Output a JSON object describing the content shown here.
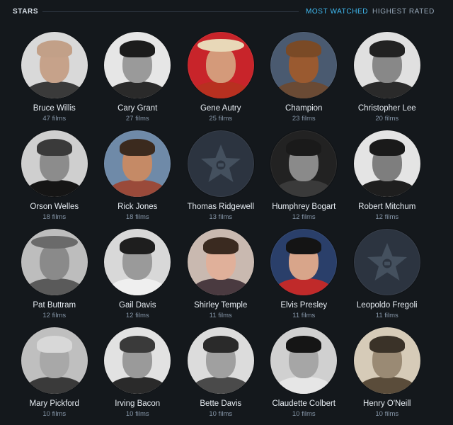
{
  "header": {
    "section_title": "STARS",
    "tab_most_watched": "MOST WATCHED",
    "tab_highest_rated": "HIGHEST RATED"
  },
  "colors": {
    "background": "#14181c",
    "accent": "#40bcf4",
    "muted": "#8696a8",
    "placeholder": "#2c3440"
  },
  "stars": [
    {
      "name": "Bruce Willis",
      "count": "47 films",
      "photo": true,
      "bg": "#d9d9d9",
      "skin": "#c6a28a",
      "hair": "#c2a088",
      "cloth": "#3a3a3a"
    },
    {
      "name": "Cary Grant",
      "count": "27 films",
      "photo": true,
      "bg": "#e6e6e6",
      "skin": "#9a9a9a",
      "hair": "#1c1c1c",
      "cloth": "#2a2a2a"
    },
    {
      "name": "Gene Autry",
      "count": "25 films",
      "photo": true,
      "bg": "#c8242a",
      "skin": "#d49a7a",
      "hair": "#e8d8b8",
      "cloth": "#b83020",
      "hat": true
    },
    {
      "name": "Champion",
      "count": "23 films",
      "photo": true,
      "bg": "#4a5a70",
      "skin": "#9a5a30",
      "hair": "#7a4a26",
      "cloth": "#6a4a34"
    },
    {
      "name": "Christopher Lee",
      "count": "20 films",
      "photo": true,
      "bg": "#e0e0e0",
      "skin": "#888888",
      "hair": "#222222",
      "cloth": "#2a2a2a"
    },
    {
      "name": "Orson Welles",
      "count": "18 films",
      "photo": true,
      "bg": "#cfcfcf",
      "skin": "#8c8c8c",
      "hair": "#3a3a3a",
      "cloth": "#151515"
    },
    {
      "name": "Rick Jones",
      "count": "18 films",
      "photo": true,
      "bg": "#6f8aa8",
      "skin": "#c58a66",
      "hair": "#3b2a1e",
      "cloth": "#9a4a3a"
    },
    {
      "name": "Thomas Ridgewell",
      "count": "13 films",
      "photo": false
    },
    {
      "name": "Humphrey Bogart",
      "count": "12 films",
      "photo": true,
      "bg": "#222222",
      "skin": "#8a8a8a",
      "hair": "#1a1a1a",
      "cloth": "#3a3a3a"
    },
    {
      "name": "Robert Mitchum",
      "count": "12 films",
      "photo": true,
      "bg": "#e4e4e4",
      "skin": "#7e7e7e",
      "hair": "#1a1a1a",
      "cloth": "#1e1e1e"
    },
    {
      "name": "Pat Buttram",
      "count": "12 films",
      "photo": true,
      "bg": "#bdbdbd",
      "skin": "#8a8a8a",
      "hair": "#6a6a6a",
      "cloth": "#5a5a5a",
      "hat": true
    },
    {
      "name": "Gail Davis",
      "count": "12 films",
      "photo": true,
      "bg": "#d8d8d8",
      "skin": "#9a9a9a",
      "hair": "#1e1e1e",
      "cloth": "#efefef"
    },
    {
      "name": "Shirley Temple",
      "count": "11 films",
      "photo": true,
      "bg": "#c9b9b0",
      "skin": "#e0b09a",
      "hair": "#3a2a20",
      "cloth": "#4a3a40"
    },
    {
      "name": "Elvis Presley",
      "count": "11 films",
      "photo": true,
      "bg": "#2a3f6a",
      "skin": "#d8a58a",
      "hair": "#141414",
      "cloth": "#c02a2a"
    },
    {
      "name": "Leopoldo Fregoli",
      "count": "11 films",
      "photo": false
    },
    {
      "name": "Mary Pickford",
      "count": "10 films",
      "photo": true,
      "bg": "#bfbfbf",
      "skin": "#a8a8a8",
      "hair": "#d8d8d8",
      "cloth": "#3a3a3a"
    },
    {
      "name": "Irving Bacon",
      "count": "10 films",
      "photo": true,
      "bg": "#e2e2e2",
      "skin": "#9a9a9a",
      "hair": "#3a3a3a",
      "cloth": "#2a2a2a"
    },
    {
      "name": "Bette Davis",
      "count": "10 films",
      "photo": true,
      "bg": "#dcdcdc",
      "skin": "#a0a0a0",
      "hair": "#2a2a2a",
      "cloth": "#4a4a4a"
    },
    {
      "name": "Claudette Colbert",
      "count": "10 films",
      "photo": true,
      "bg": "#d0d0d0",
      "skin": "#a6a6a6",
      "hair": "#151515",
      "cloth": "#e6e6e6"
    },
    {
      "name": "Henry O'Neill",
      "count": "10 films",
      "photo": true,
      "bg": "#d6cbb8",
      "skin": "#9a8a74",
      "hair": "#3a3228",
      "cloth": "#5a4c3a"
    }
  ]
}
